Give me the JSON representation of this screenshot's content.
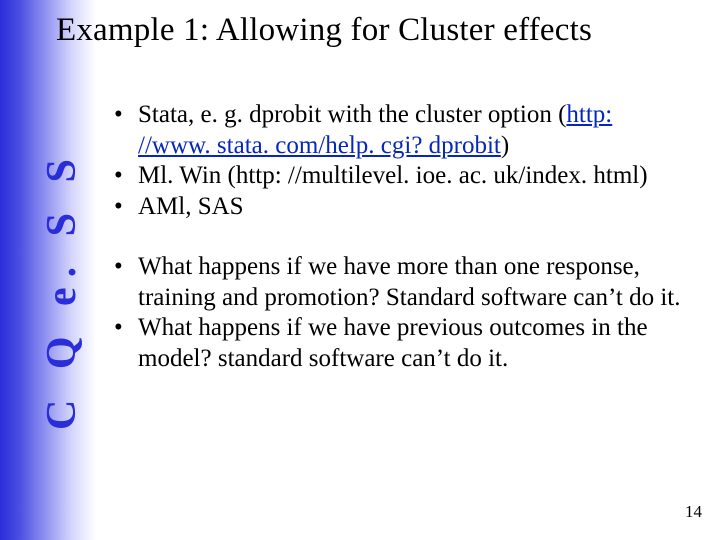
{
  "title": "Example 1: Allowing for Cluster effects",
  "sidebar": "C Q e. S S",
  "bullets_a": [
    {
      "pre": "Stata, e. g. dprobit with the cluster option (",
      "link": "http: //www. stata. com/help. cgi? dprobit",
      "post": ")"
    },
    {
      "text": "Ml. Win (http: //multilevel. ioe. ac. uk/index. html)"
    },
    {
      "text": "AMl, SAS"
    }
  ],
  "bullets_b": [
    {
      "text": "What happens if we have more than one response, training and promotion? Standard software can’t do it."
    },
    {
      "text": "What happens if we have previous outcomes in the model? standard software can’t do it."
    }
  ],
  "page_number": "14"
}
